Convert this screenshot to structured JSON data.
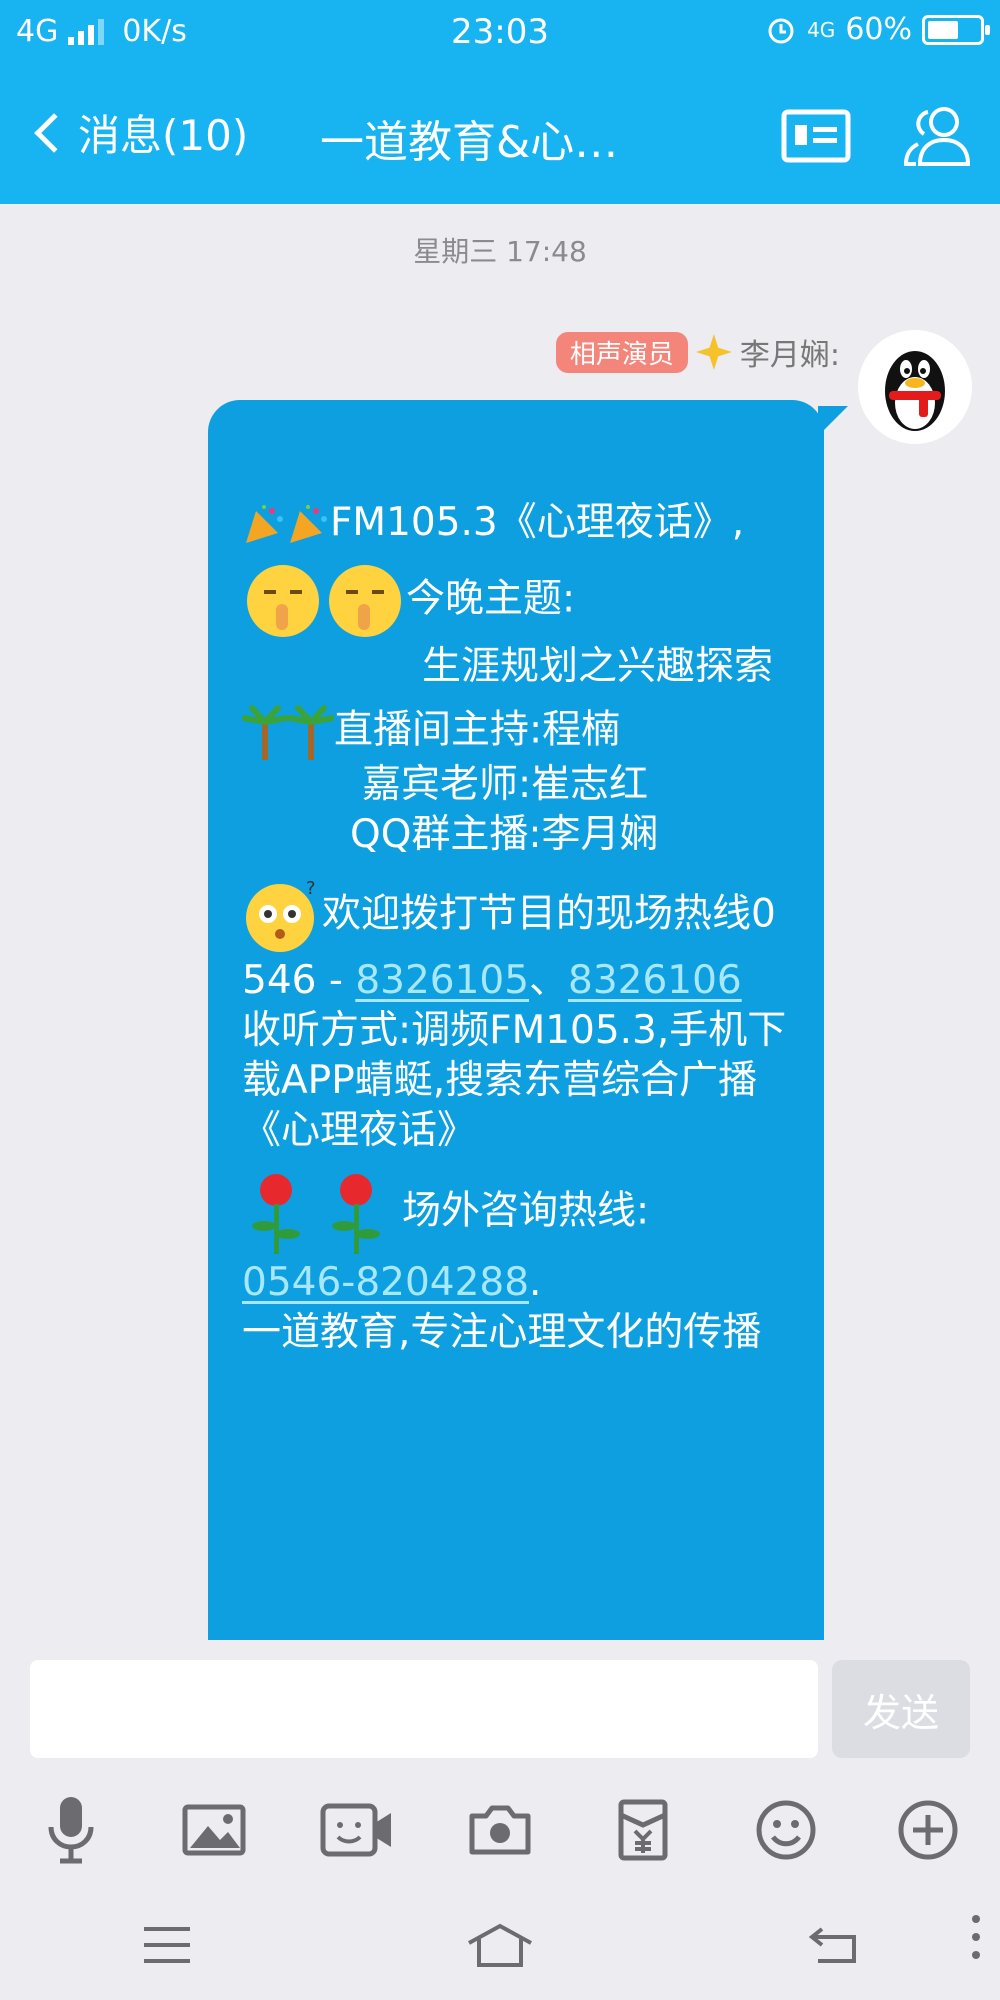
{
  "status_bar": {
    "network": "4G",
    "speed": "0K/s",
    "time": "23:03",
    "sim_net": "4G",
    "battery_text": "60%",
    "battery_level": 0.6
  },
  "header": {
    "back_label": "消息(10)",
    "title": "一道教育&心…"
  },
  "chat": {
    "timestamp": "星期三 17:48",
    "sender_badge": "相声演员",
    "sender_name": "李月娴:",
    "lines": {
      "l1": "FM105.3《心理夜话》,",
      "l2a": "今晚主题:",
      "l2b": "生涯规划之兴趣探索",
      "l3a": "直播间主持:程楠",
      "l3b": "嘉宾老师:崔志红",
      "l3c": "QQ群主播:李月娴",
      "l4a": "欢迎拨打节目的现场热线0546 - ",
      "l4link1": "8326105",
      "l4sep": "、",
      "l4link2": "8326106",
      "l5": "收听方式:调频FM105.3,手机下载APP蜻蜓,搜索东营综合广播《心理夜话》",
      "l6a": "场外咨询热线:",
      "l6link": "0546-8204288",
      "l6end": ".",
      "l7": "一道教育,专注心理文化的传播"
    }
  },
  "input": {
    "value": "",
    "send_label": "发送"
  },
  "colors": {
    "header_bg": "#18b4f2",
    "bubble_bg": "#0e9fe0",
    "link": "#a8e8ff",
    "badge": "#f4857a"
  },
  "toolbar_icons": [
    "microphone-icon",
    "picture-icon",
    "video-icon",
    "camera-icon",
    "red-packet-icon",
    "emoji-icon",
    "plus-icon"
  ],
  "nav_icons": [
    "menu-icon",
    "home-icon",
    "back-icon"
  ]
}
